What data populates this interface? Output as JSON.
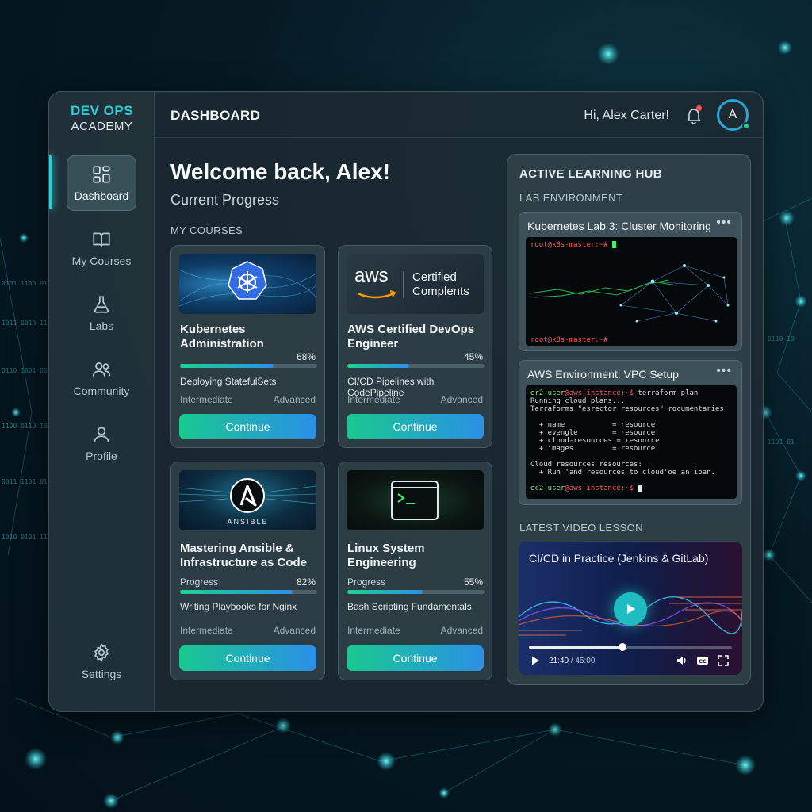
{
  "brand": {
    "line1": "DEV OPS",
    "line2": "ACADEMY"
  },
  "sidebar": {
    "items": [
      {
        "label": "Dashboard",
        "icon": "dashboard-grid-icon",
        "active": true
      },
      {
        "label": "My Courses",
        "icon": "book-icon",
        "active": false
      },
      {
        "label": "Labs",
        "icon": "flask-icon",
        "active": false
      },
      {
        "label": "Community",
        "icon": "users-icon",
        "active": false
      },
      {
        "label": "Profile",
        "icon": "user-icon",
        "active": false
      }
    ],
    "settings_label": "Settings"
  },
  "header": {
    "title": "DASHBOARD",
    "greeting": "Hi, Alex Carter!",
    "avatar_initial": "A"
  },
  "main": {
    "welcome": "Welcome back, Alex!",
    "subtitle": "Current Progress",
    "courses_label": "MY COURSES",
    "courses": [
      {
        "title_line1": "Kubernetes",
        "title_line2": "Administration",
        "progress_label": "",
        "progress": 68,
        "progress_text": "68%",
        "lesson": "Deploying StatefulSets",
        "level_min": "Intermediate",
        "level_max": "Advanced",
        "button": "Continue",
        "thumb_icon": "kubernetes-helm-icon"
      },
      {
        "title_line1": "AWS Certified DevOps",
        "title_line2": "Engineer",
        "progress_label": "",
        "progress": 45,
        "progress_text": "45%",
        "lesson": "CI/CD Pipelines with CodePipeline",
        "level_min": "Intermediate",
        "level_max": "Advanced",
        "button": "Continue",
        "thumb_logo": "aws",
        "thumb_text_1": "Certified",
        "thumb_text_2": "Complents"
      },
      {
        "title_line1": "Mastering Ansible &",
        "title_line2": "Infrastructure as Code",
        "progress_label": "Progress",
        "progress": 82,
        "progress_text": "82%",
        "lesson": "Writing Playbooks for Nginx",
        "level_min": "Intermediate",
        "level_max": "Advanced",
        "button": "Continue",
        "thumb_caption": "ANSIBLE"
      },
      {
        "title_line1": "Linux System",
        "title_line2": "Engineering",
        "progress_label": "Progress",
        "progress": 55,
        "progress_text": "55%",
        "lesson": "Bash Scripting Fundamentals",
        "level_min": "Intermediate",
        "level_max": "Advanced",
        "button": "Continue",
        "thumb_icon": "terminal-window-icon"
      }
    ]
  },
  "hub": {
    "title": "ACTIVE LEARNING HUB",
    "lab_env_label": "LAB ENVIRONMENT",
    "lab1": {
      "title": "Kubernetes Lab 3: Cluster Monitoring",
      "menu": "•••",
      "prompt_top": "root@k8s-master:~#",
      "prompt_bottom": "root@k8s-master:~#"
    },
    "lab2": {
      "title": "AWS Environment: VPC Setup",
      "menu": "•••",
      "prompt_user": "er2-user",
      "prompt_host": "@aws-instance:~$",
      "command": " terraform plan",
      "lines": [
        "Running cloud plans...",
        "Terraforms \"esrector resources\" rocumentaries!",
        "",
        "  + name           = resource",
        "  + evengle        = resource",
        "  + cloud-resources = resource",
        "  + images         = resource",
        "",
        "Cloud resources resources:",
        "  + Run 'and resources to cloud'oe an ioan."
      ],
      "prompt_end_user": "ec2-user",
      "prompt_end_host": "@aws-instance:~$"
    },
    "video_label": "LATEST VIDEO LESSON",
    "video": {
      "title": "CI/CD in Practice (Jenkins & GitLab)",
      "current": "21:40",
      "total": " / 45:00",
      "progress": 0.46
    }
  },
  "colors": {
    "accent": "#2ad0d8",
    "button_start": "#19c98f",
    "button_end": "#2b8fe8",
    "notification": "#ff4d4d",
    "online": "#22d08a"
  }
}
